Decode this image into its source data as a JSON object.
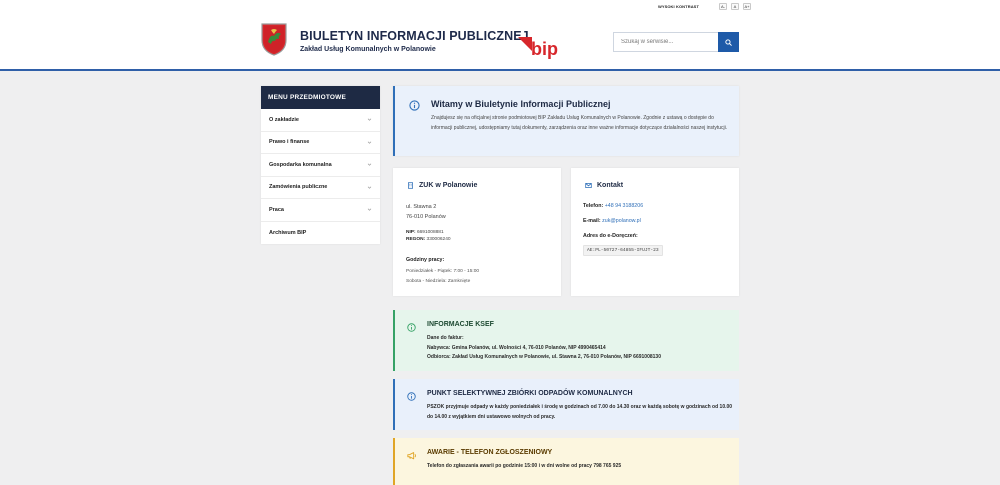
{
  "topbar": {
    "contrast_label": "WYSOKI KONTRAST",
    "font_small": "A-",
    "font_normal": "A",
    "font_large": "A+"
  },
  "header": {
    "title": "BIULETYN INFORMACJI PUBLICZNEJ",
    "subtitle": "Zakład Usług Komunalnych w Polanowie",
    "logo_text": "bip",
    "crest_text": "",
    "search_placeholder": "Szukaj w serwisie..."
  },
  "colors": {
    "accent": "#1e5aa8",
    "navy": "#1e2a44",
    "bip_red": "#d7262b",
    "success": "#36a266",
    "warning": "#e0a526"
  },
  "sidebar": {
    "heading": "MENU PRZEDMIOTOWE",
    "items": [
      {
        "label": "O zakładzie",
        "has_chevron": true
      },
      {
        "label": "Prawo i finanse",
        "has_chevron": true
      },
      {
        "label": "Gospodarka komunalna",
        "has_chevron": true
      },
      {
        "label": "Zamówienia publiczne",
        "has_chevron": true
      },
      {
        "label": "Praca",
        "has_chevron": true
      },
      {
        "label": "Archiwum BIP",
        "has_chevron": false
      }
    ]
  },
  "welcome": {
    "heading": "Witamy w Biuletynie Informacji Publicznej",
    "body": "Znajdujesz się na oficjalnej stronie podmiotowej BIP Zakładu Usług Komunalnych w Polanowie. Zgodnie z ustawą o dostępie do informacji publicznej, udostępniamy tutaj dokumenty, zarządzenia oraz inne ważne informacje dotyczące działalności naszej instytucji."
  },
  "zuk": {
    "heading": "ZUK w Polanowie",
    "street": "ul. Stawna 2",
    "city": "76-010 Polanów",
    "nip_label": "NIP:",
    "nip": "6691008881",
    "regon_label": "REGON:",
    "regon": "330006240",
    "hours_heading": "Godziny pracy:",
    "hours_weekdays": "Poniedziałek - Piątek: 7:00 - 15:00",
    "hours_saturday": "Sobota - Niedziela: Zamknięte"
  },
  "kontakt": {
    "heading": "Kontakt",
    "phone_label": "Telefon:",
    "phone": "+48 94 3188206",
    "email_label": "E-mail:",
    "email": "zuk@polanow.pl",
    "edelivery_label": "Adres do e-Doręczeń:",
    "edelivery": "AE:PL-50727-64855-IFUJT-23"
  },
  "ksef": {
    "heading": "INFORMACJE KSEF",
    "invoice_label": "Dane do faktur:",
    "buyer_label": "Nabywca:",
    "buyer": "Gmina Polanów, ul. Wolności 4, 76-010 Polanów, NIP 4990465414",
    "recipient_label": "Odbiorca:",
    "recipient": "Zakład Usług Komunalnych w Polanowie, ul. Stawna 2, 76-010 Polanów, NIP 6691008130"
  },
  "pszok": {
    "heading": "PUNKT SELEKTYWNEJ ZBIÓRKI ODPADÓW KOMUNALNYCH",
    "body": "PSZOK przyjmuje odpady w każdy poniedziałek i środę w godzinach od 7.00 do 14.30 oraz w każdą sobotę w godzinach od 10.00 do 14.00 z wyjątkiem dni ustawowo wolnych od pracy."
  },
  "awarie": {
    "heading": "AWARIE - TELEFON ZGŁOSZENIOWY",
    "body": "Telefon do zgłaszania awarii po godzinie 15:00 i w dni wolne od pracy 798 765 925"
  }
}
